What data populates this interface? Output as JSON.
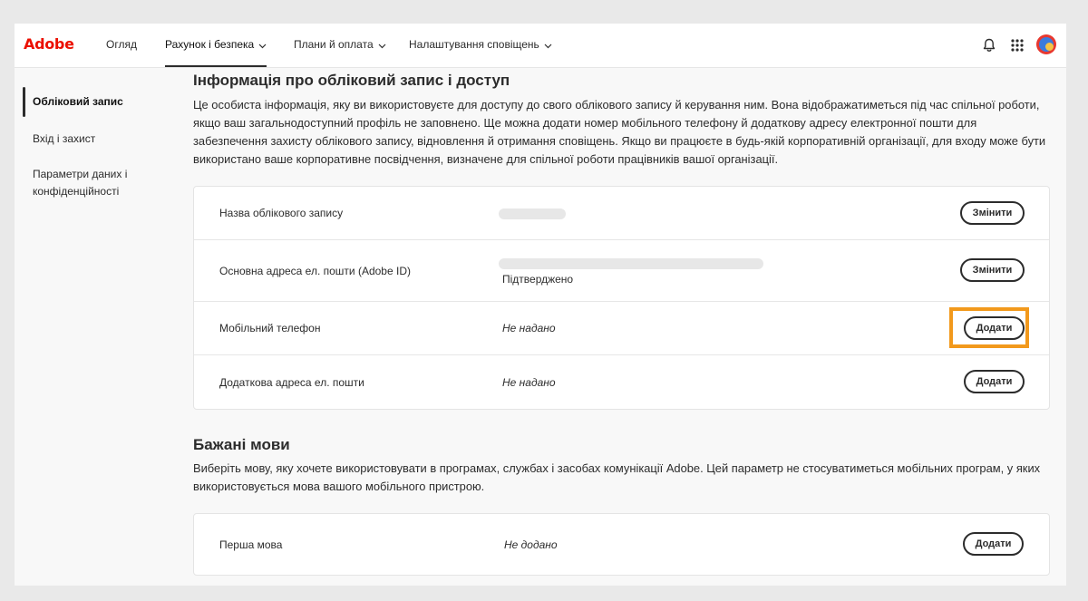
{
  "brand": {
    "logo_text": "Adobe",
    "logo_color": "#eb1000"
  },
  "nav": {
    "tabs": [
      {
        "label": "Огляд"
      },
      {
        "label": "Рахунок і безпека"
      },
      {
        "label": "Плани й оплата"
      },
      {
        "label": "Налаштування сповіщень"
      }
    ],
    "active_tab": "Рахунок і безпека",
    "icons": [
      "bell-icon",
      "apps-grid-icon",
      "avatar"
    ]
  },
  "sidebar": {
    "items": [
      {
        "label": "Обліковий запис"
      },
      {
        "label": "Вхід і захист"
      },
      {
        "label": "Параметри даних і конфіденційності"
      }
    ],
    "active_item": "Обліковий запис"
  },
  "account_section": {
    "title": "Інформація про обліковий запис і доступ",
    "description": "Це особиста інформація, яку ви використовуєте для доступу до свого облікового запису й керування ним. Вона відображатиметься під час спільної роботи, якщо ваш загальнодоступний профіль не заповнено. Ще можна додати номер мобільного телефону й додаткову адресу електронної пошти для забезпечення захисту облікового запису, відновлення й отримання сповіщень. Якщо ви працюєте в будь-якій корпоративній організації, для входу може бути використано ваше корпоративне посвідчення, визначене для спільної роботи працівників вашої організації.",
    "rows": [
      {
        "label": "Назва облікового запису",
        "value": "",
        "button": "Змінити"
      },
      {
        "label": "Основна адреса ел. пошти (Adobe ID)",
        "value": "",
        "status": "Підтверджено",
        "button": "Змінити"
      },
      {
        "label": "Мобільний телефон",
        "value": "Не надано",
        "button": "Додати"
      },
      {
        "label": "Додаткова адреса ел. пошти",
        "value": "Не надано",
        "button": "Додати"
      }
    ]
  },
  "language_section": {
    "title": "Бажані мови",
    "description": "Виберіть мову, яку хочете використовувати в програмах, службах і засобах комунікації Adobe. Цей параметр не стосуватиметься мобільних програм, у яких використовується мова вашого мобільного пристрою.",
    "rows": [
      {
        "label": "Перша мова",
        "value": "Не додано",
        "button": "Додати"
      }
    ]
  },
  "colors": {
    "highlight": "#f2991c",
    "text": "#2c2c2c"
  }
}
